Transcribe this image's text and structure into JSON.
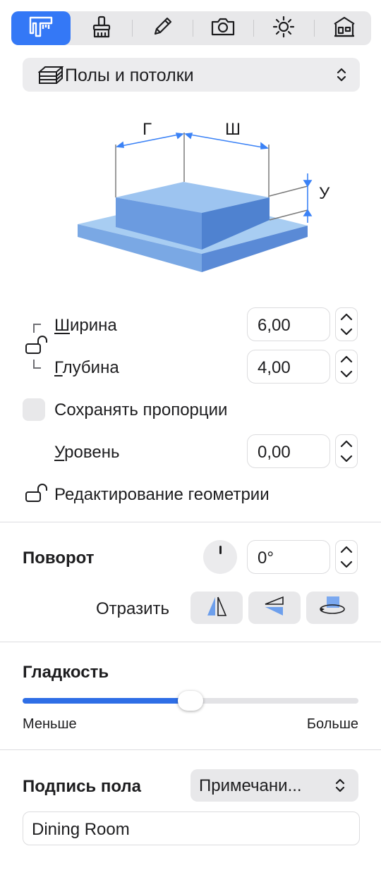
{
  "toolbar": {
    "tabs": [
      {
        "name": "measure",
        "icon": "caliper-icon",
        "active": true
      },
      {
        "name": "paint",
        "icon": "paint-brush-icon",
        "active": false
      },
      {
        "name": "pencil",
        "icon": "pencil-icon",
        "active": false
      },
      {
        "name": "camera",
        "icon": "camera-icon",
        "active": false
      },
      {
        "name": "light",
        "icon": "sun-icon",
        "active": false
      },
      {
        "name": "building",
        "icon": "house-icon",
        "active": false
      }
    ]
  },
  "category": {
    "label": "Полы и потолки",
    "icon": "floor-slab-icon"
  },
  "diagram": {
    "label_g": "Г",
    "label_w": "Ш",
    "label_h": "У"
  },
  "width": {
    "first": "Ш",
    "rest": "ирина",
    "value": "6,00"
  },
  "depth": {
    "first": "Г",
    "rest": "лубина",
    "value": "4,00"
  },
  "keep_proportions": {
    "label": "Сохранять пропорции",
    "checked": false
  },
  "level": {
    "first": "У",
    "rest": "ровень",
    "value": "0,00"
  },
  "edit_geometry": {
    "label": "Редактирование геометрии"
  },
  "rotation": {
    "title": "Поворот",
    "value": "0°"
  },
  "mirror": {
    "label": "Отразить"
  },
  "smoothness": {
    "title": "Гладкость",
    "min_label": "Меньше",
    "max_label": "Больше",
    "value": 0.5
  },
  "floor_label": {
    "title": "Подпись пола",
    "popup_value": "Примечани...",
    "text_value": "Dining Room"
  },
  "colors": {
    "accent": "#3478f6",
    "slab_top": "#9dc4f0",
    "slab_side": "#5b8fd6"
  }
}
